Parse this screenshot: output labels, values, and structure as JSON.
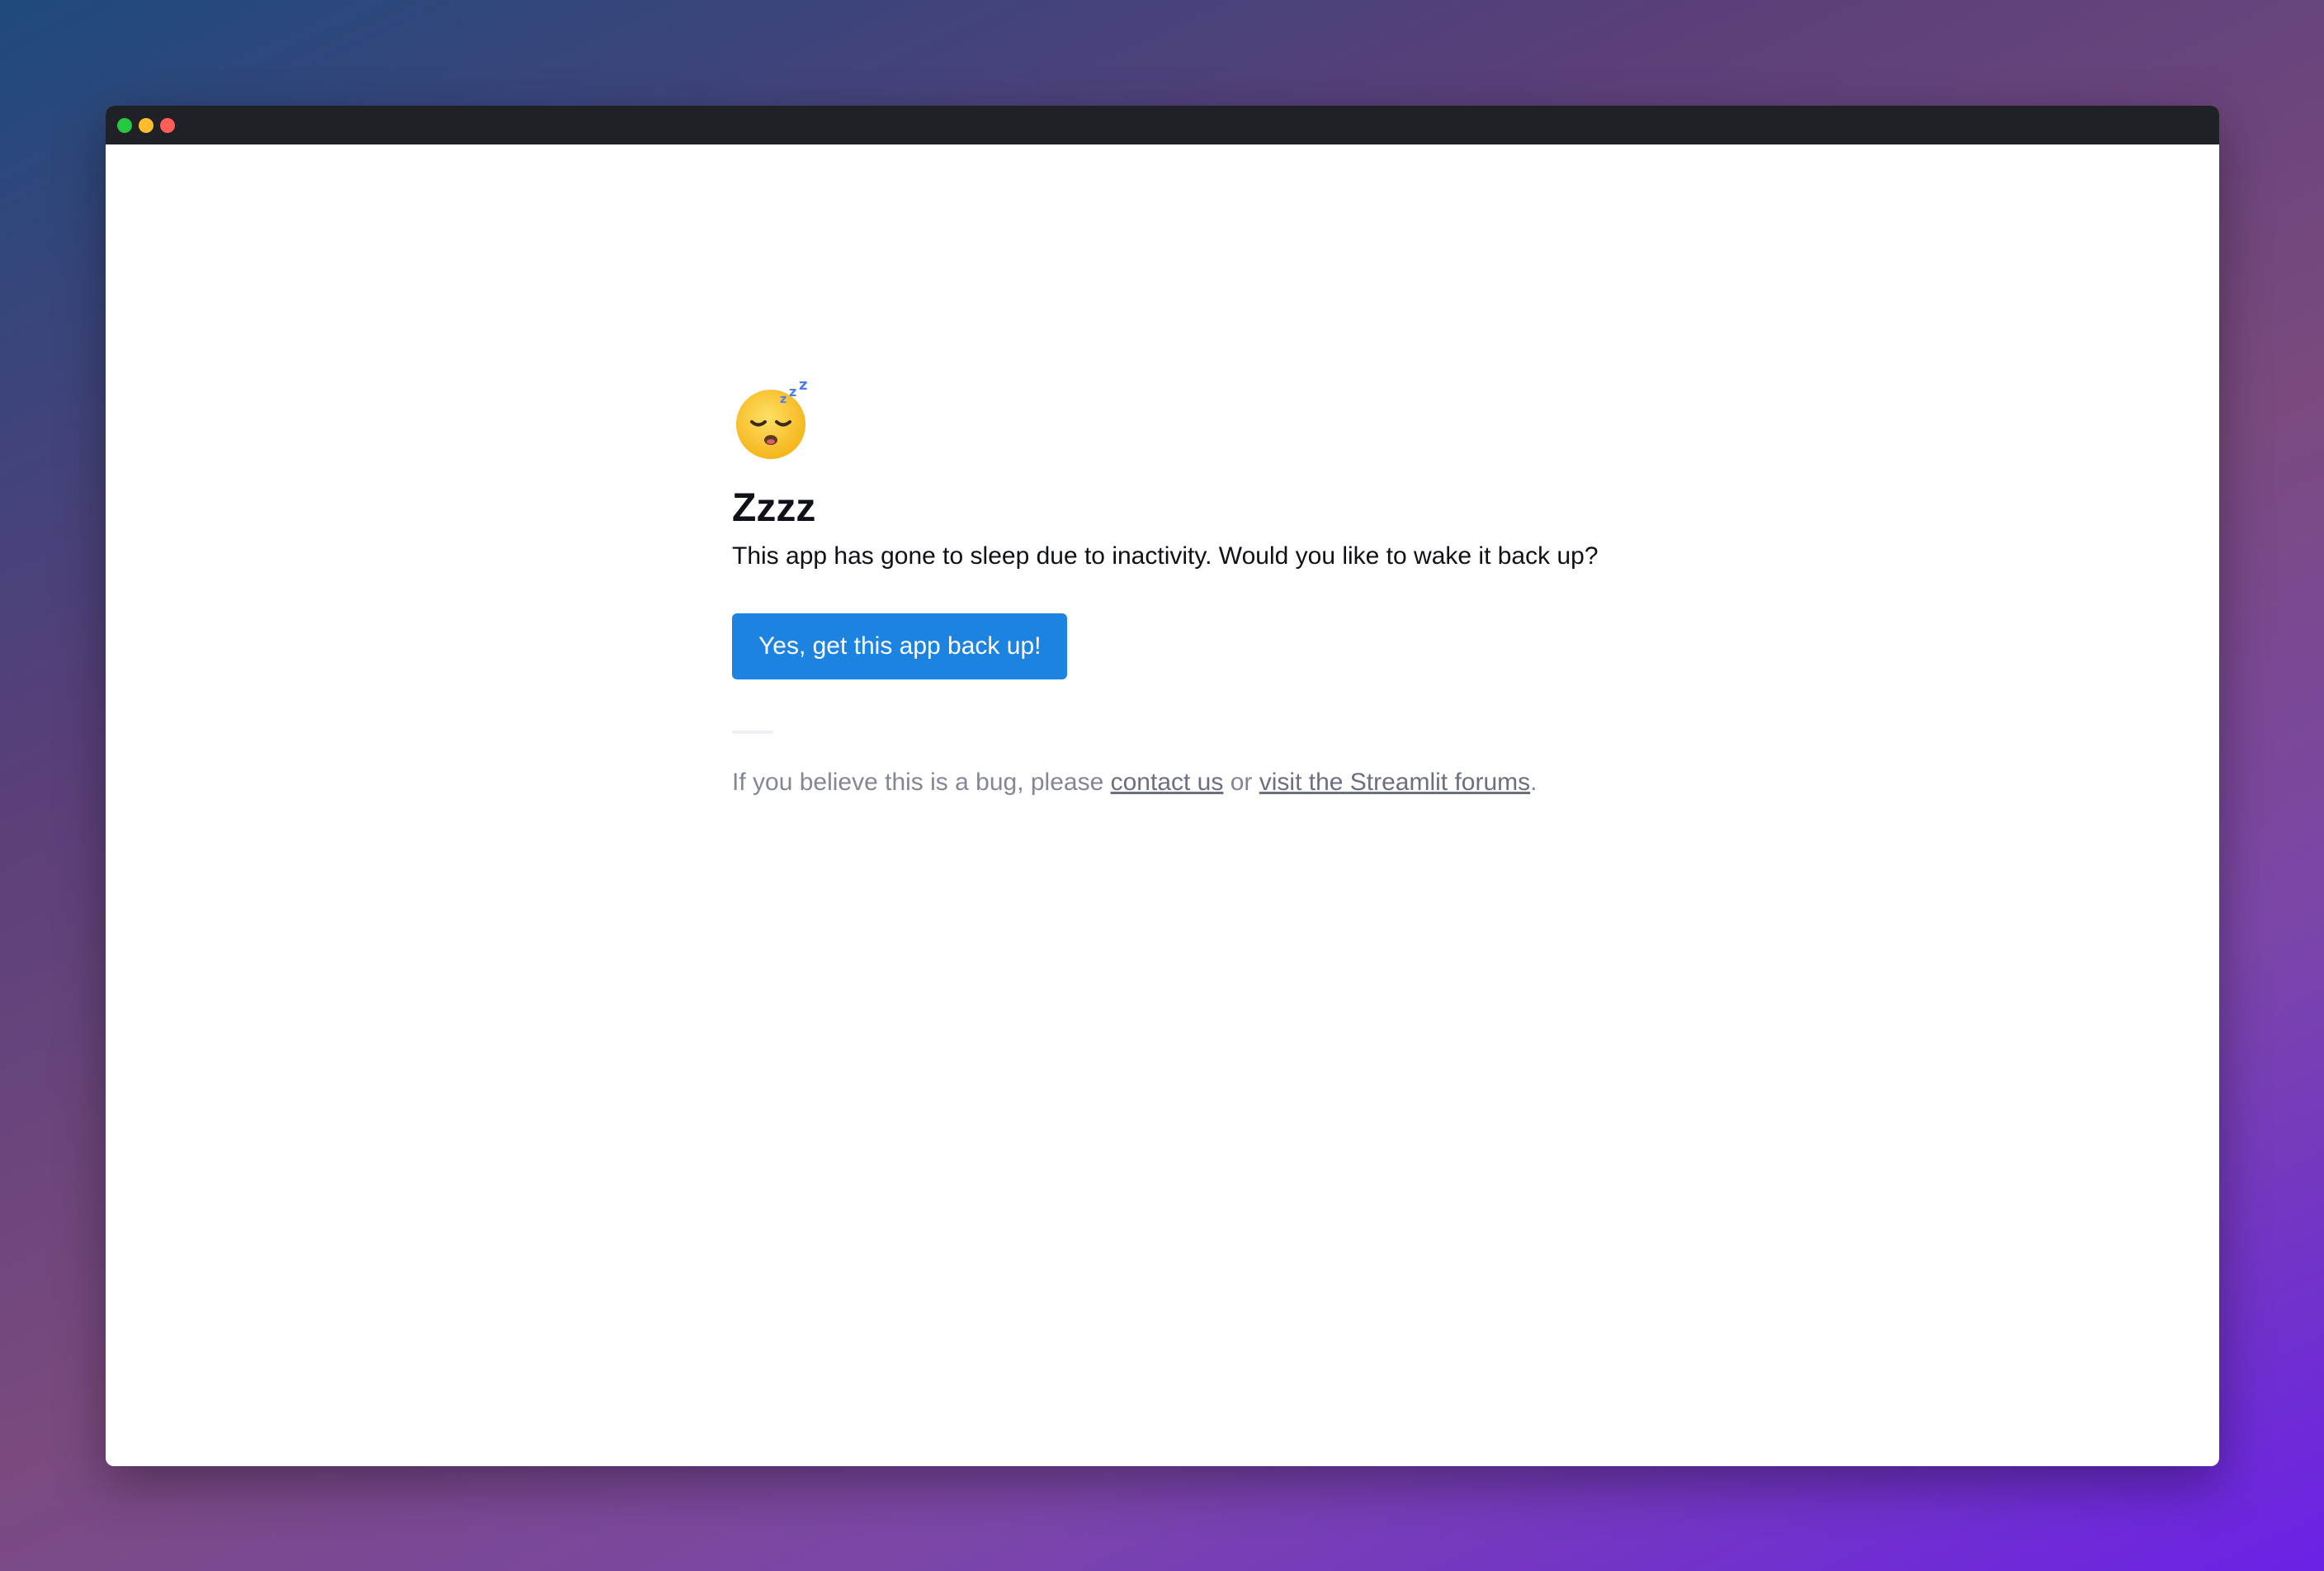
{
  "window": {
    "controls": [
      "green",
      "yellow",
      "red"
    ]
  },
  "icon": "sleeping-face-emoji",
  "main": {
    "title": "Zzzz",
    "message": "This app has gone to sleep due to inactivity. Would you like to wake it back up?",
    "wake_button_label": "Yes, get this app back up!"
  },
  "footer": {
    "prefix": "If you believe this is a bug, please ",
    "contact_link": "contact us",
    "middle": " or ",
    "forums_link": "visit the Streamlit forums",
    "suffix": "."
  },
  "colors": {
    "button": "#1c83e1",
    "titlebar": "#202126",
    "muted_text": "#838795"
  }
}
